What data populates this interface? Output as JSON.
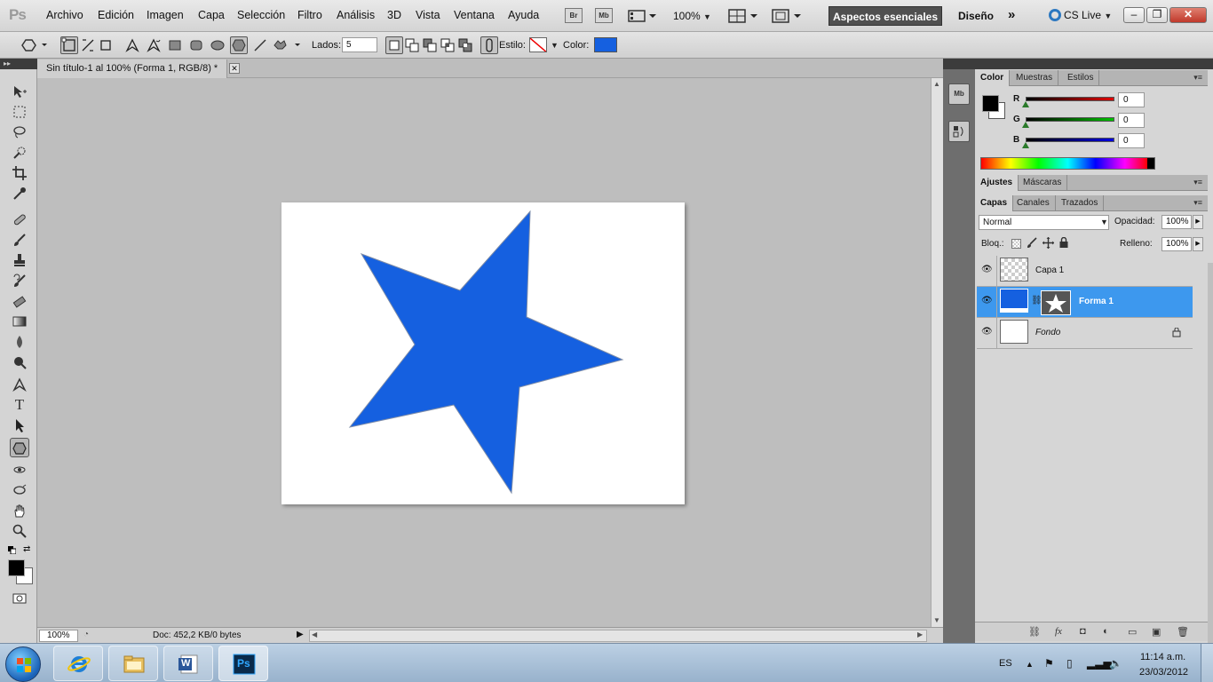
{
  "app": {
    "logo": "Ps",
    "menu": [
      "Archivo",
      "Edición",
      "Imagen",
      "Capa",
      "Selección",
      "Filtro",
      "Análisis",
      "3D",
      "Vista",
      "Ventana",
      "Ayuda"
    ],
    "bridge_label": "Br",
    "minibridge_label": "Mb",
    "zoom": "100%",
    "workspace_active": "Aspectos esenciales",
    "workspace_other": "Diseño",
    "more": "»",
    "cs_live": "CS Live",
    "win_minimize": "‒",
    "win_restore": "❐",
    "win_close": "✕"
  },
  "options": {
    "lados_label": "Lados:",
    "lados_value": "5",
    "estilo_label": "Estilo:",
    "color_label": "Color:",
    "color_value": "#1560e0"
  },
  "document": {
    "tab_title": "Sin título-1 al 100% (Forma 1, RGB/8) *",
    "tab_close": "✕",
    "shape_color": "#1560e0",
    "canvas_bg": "#ffffff"
  },
  "status": {
    "zoom": "100%",
    "doc_info": "Doc: 452,2 KB/0 bytes"
  },
  "dock": {
    "minibridge": "Mb"
  },
  "color_panel": {
    "tabs": [
      "Color",
      "Muestras",
      "Estilos"
    ],
    "channels": [
      {
        "label": "R",
        "value": "0",
        "color": "#e00000"
      },
      {
        "label": "G",
        "value": "0",
        "color": "#00c000"
      },
      {
        "label": "B",
        "value": "0",
        "color": "#0000e0"
      }
    ],
    "foreground": "#000000",
    "background": "#ffffff"
  },
  "adjust_panel": {
    "tabs": [
      "Ajustes",
      "Máscaras"
    ]
  },
  "layers_panel": {
    "tabs": [
      "Capas",
      "Canales",
      "Trazados"
    ],
    "blend_mode": "Normal",
    "opacity_label": "Opacidad:",
    "opacity_value": "100%",
    "lock_label": "Bloq.:",
    "fill_label": "Relleno:",
    "fill_value": "100%",
    "layers": [
      {
        "name": "Capa 1",
        "selected": false
      },
      {
        "name": "Forma 1",
        "selected": true
      },
      {
        "name": "Fondo",
        "selected": false
      }
    ]
  },
  "taskbar": {
    "lang": "ES",
    "time": "11:14 a.m.",
    "date": "23/03/2012",
    "word_label": "W",
    "ps_label": "Ps"
  }
}
